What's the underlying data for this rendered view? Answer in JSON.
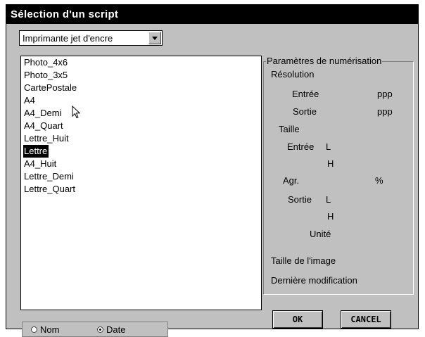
{
  "window": {
    "title": "Sélection d'un script"
  },
  "printer_select": {
    "value": "Imprimante jet d'encre"
  },
  "scripts": {
    "items": [
      "Photo_4x6",
      "Photo_3x5",
      "CartePostale",
      "A4",
      "A4_Demi",
      "A4_Quart",
      "Lettre_Huit",
      "Lettre",
      "A4_Huit",
      "Lettre_Demi",
      "Lettre_Quart"
    ],
    "selected_index": 7
  },
  "params": {
    "legend": "Paramètres de numérisation",
    "resolution": "Résolution",
    "input": "Entrée",
    "output": "Sortie",
    "ppp": "ppp",
    "size": "Taille",
    "width_L": "L",
    "height_H": "H",
    "enlarge": "Agr.",
    "percent": "%",
    "unit": "Unité",
    "image_size": "Taille de l'image",
    "last_modified": "Dernière modification"
  },
  "sort": {
    "name_label": "Nom",
    "date_label": "Date",
    "selected": "date"
  },
  "buttons": {
    "ok": "OK",
    "cancel": "CANCEL"
  },
  "colors": {
    "face": "#c0c0c0",
    "title_bg": "#000000",
    "selection_bg": "#000000"
  }
}
